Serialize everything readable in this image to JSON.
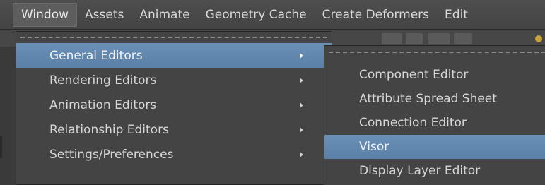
{
  "menubar": {
    "items": [
      {
        "label": "Window"
      },
      {
        "label": "Assets"
      },
      {
        "label": "Animate"
      },
      {
        "label": "Geometry Cache"
      },
      {
        "label": "Create Deformers"
      },
      {
        "label": "Edit"
      }
    ]
  },
  "window_menu": {
    "items": [
      {
        "label": "General Editors",
        "highlighted": true
      },
      {
        "label": "Rendering Editors"
      },
      {
        "label": "Animation Editors"
      },
      {
        "label": "Relationship Editors"
      },
      {
        "label": "Settings/Preferences"
      }
    ]
  },
  "general_editors_submenu": {
    "items": [
      {
        "label": "Component Editor"
      },
      {
        "label": "Attribute Spread Sheet"
      },
      {
        "label": "Connection Editor"
      },
      {
        "label": "Visor",
        "highlighted": true
      },
      {
        "label": "Display Layer Editor"
      }
    ]
  },
  "colors": {
    "highlight": "#5f86ae",
    "menu_bg": "#444444",
    "text": "#d6d6d6"
  }
}
